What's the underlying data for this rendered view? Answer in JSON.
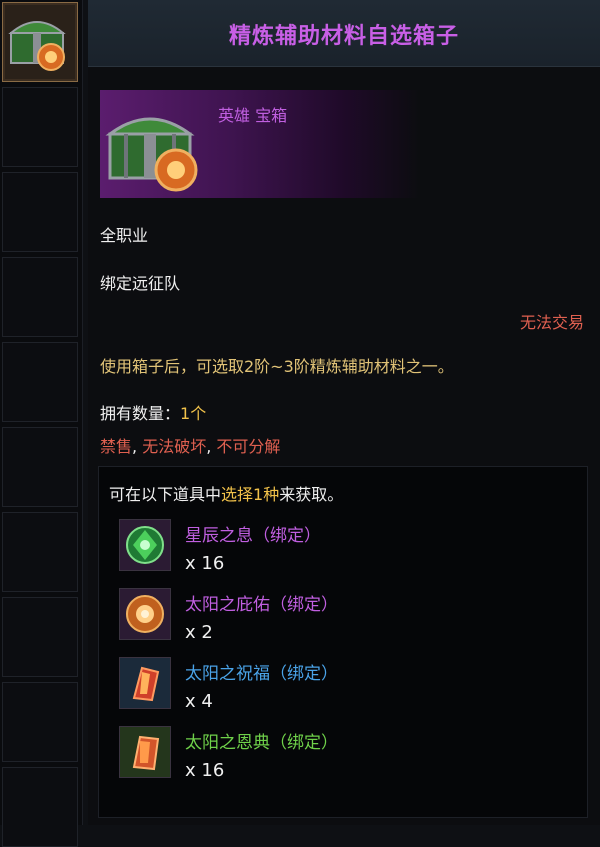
{
  "sidebar": {
    "slots": 10,
    "selected_index": 0
  },
  "header": {
    "title": "精炼辅助材料自选箱子"
  },
  "item": {
    "grade_label": "英雄 宝箱",
    "class_text": "全职业",
    "bind_text": "绑定远征队",
    "trade_text": "无法交易",
    "description": "使用箱子后，可选取2阶~3阶精炼辅助材料之一。",
    "owned_label": "拥有数量：",
    "owned_count": "1个",
    "restrict_1": "禁售",
    "restrict_sep1": ", ",
    "restrict_2": "无法破坏",
    "restrict_sep2": ", ",
    "restrict_3": "不可分解"
  },
  "rewards": {
    "head_prefix": "可在以下道具中",
    "head_highlight": "选择1种",
    "head_suffix": "来获取。",
    "items": [
      {
        "name": "星辰之息（绑定）",
        "count": "x 16",
        "name_color": "#c05fe0",
        "icon": "green-gem-icon"
      },
      {
        "name": "太阳之庇佑（绑定）",
        "count": "x 2",
        "name_color": "#c05fe0",
        "icon": "orange-gem-icon"
      },
      {
        "name": "太阳之祝福（绑定）",
        "count": "x 4",
        "name_color": "#4aa3e8",
        "icon": "red-crystal-icon"
      },
      {
        "name": "太阳之恩典（绑定）",
        "count": "x 16",
        "name_color": "#6fd14a",
        "icon": "orange-crystal-icon"
      }
    ]
  }
}
